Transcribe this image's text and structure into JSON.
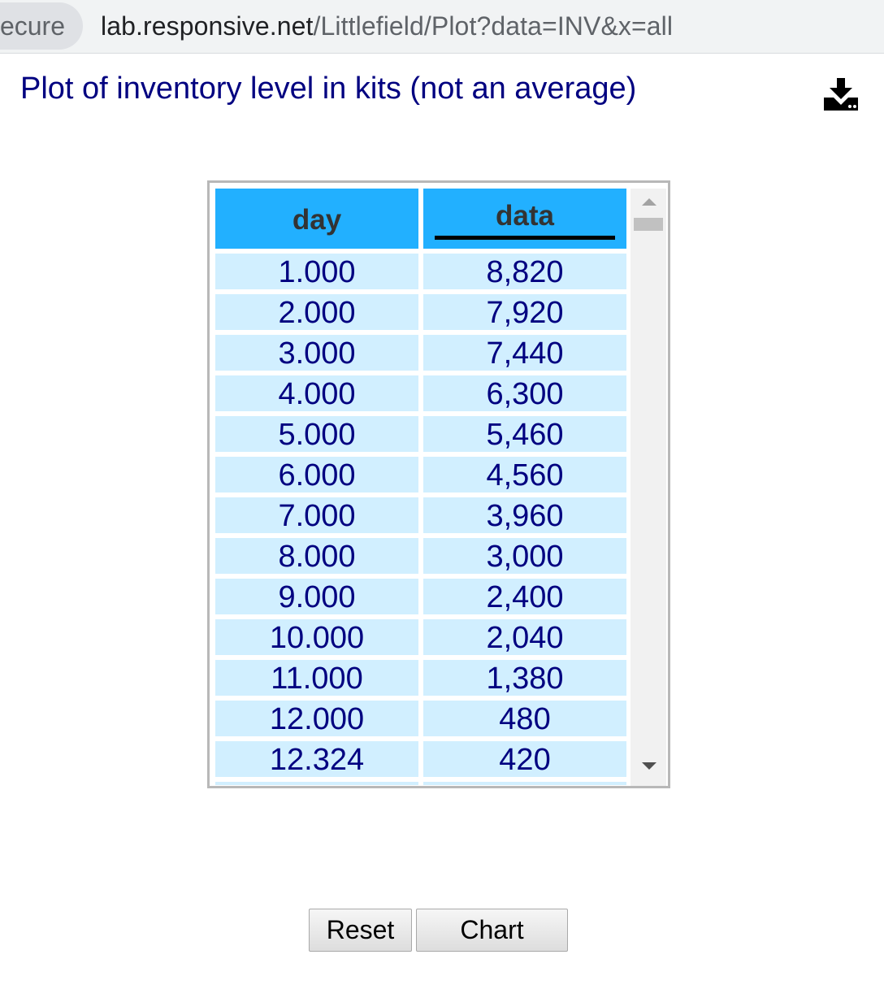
{
  "browser": {
    "secure_label": "ecure",
    "url_host": "lab.responsive.net",
    "url_path": "/Littlefield/Plot?data=INV&x=all"
  },
  "page": {
    "title": "Plot of inventory level in kits (not an average)",
    "download_icon": "download-icon"
  },
  "table": {
    "columns": [
      "day",
      "data"
    ],
    "rows": [
      {
        "day": "1.000",
        "data": "8,820"
      },
      {
        "day": "2.000",
        "data": "7,920"
      },
      {
        "day": "3.000",
        "data": "7,440"
      },
      {
        "day": "4.000",
        "data": "6,300"
      },
      {
        "day": "5.000",
        "data": "5,460"
      },
      {
        "day": "6.000",
        "data": "4,560"
      },
      {
        "day": "7.000",
        "data": "3,960"
      },
      {
        "day": "8.000",
        "data": "3,000"
      },
      {
        "day": "9.000",
        "data": "2,400"
      },
      {
        "day": "10.000",
        "data": "2,040"
      },
      {
        "day": "11.000",
        "data": "1,380"
      },
      {
        "day": "12.000",
        "data": "480"
      },
      {
        "day": "12.324",
        "data": "420"
      }
    ],
    "sorted_column": "data"
  },
  "buttons": {
    "reset": "Reset",
    "chart": "Chart"
  },
  "colors": {
    "header_bg": "#22b0ff",
    "cell_bg": "#d1efff",
    "text_navy": "#000080"
  }
}
